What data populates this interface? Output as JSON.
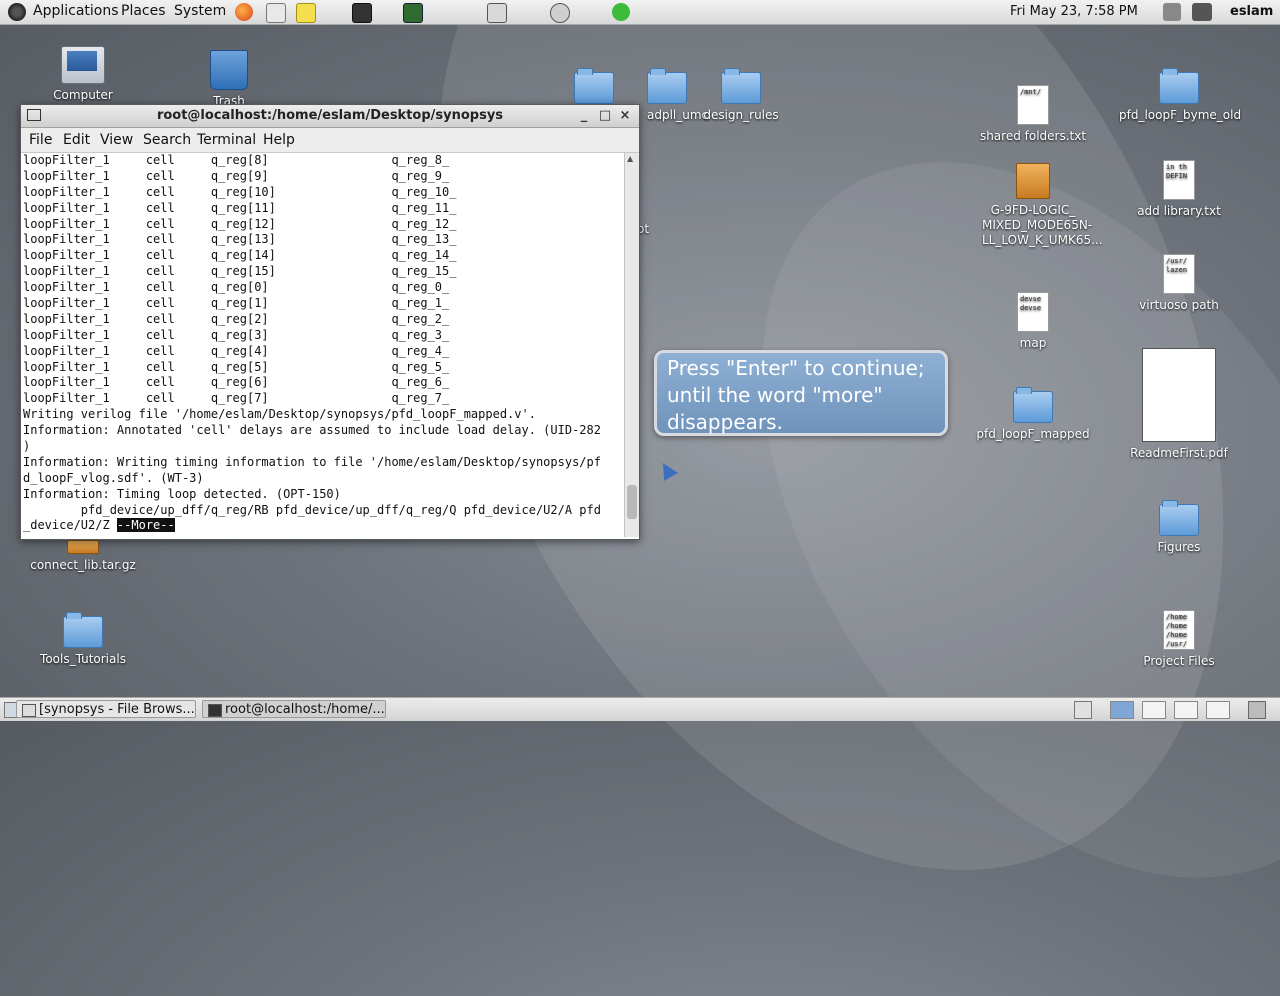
{
  "top_panel": {
    "menus": [
      "Applications",
      "Places",
      "System"
    ],
    "clock": "Fri May 23,  7:58 PM",
    "user": "eslam"
  },
  "desktop_icons": {
    "computer": "Computer",
    "trash": "Trash",
    "connect_lib": "connect_lib.tar.gz",
    "tools_tutorials": "Tools_Tutorials",
    "adpll_umc": "adpll_umc",
    "design_rules": "design_rules",
    "partial_label": "ot",
    "shared_folders": "shared folders.txt",
    "g9fd": "G-9FD-LOGIC_ MIXED_MODE65N- LL_LOW_K_UMK65...",
    "map": "map",
    "pfd_mapped": "pfd_loopF_mapped",
    "pfd_byme_old": "pfd_loopF_byme_old",
    "add_library": "add library.txt",
    "virtuoso_path": "virtuoso path",
    "readme": "ReadmeFirst.pdf",
    "figures": "Figures",
    "project_files": "Project Files"
  },
  "doc_thumbs": {
    "shared": "/mnt/",
    "add_library": "in th\nDEFIN",
    "virtuoso": "/usr/\nlazen",
    "map": "devse\ndevse",
    "project": "/home\n/home\n/home\n/usr/"
  },
  "terminal": {
    "title": "root@localhost:/home/eslam/Desktop/synopsys",
    "menu": [
      "File",
      "Edit",
      "View",
      "Search",
      "Terminal",
      "Help"
    ],
    "lines": [
      "loopFilter_1     cell     q_reg[8]                 q_reg_8_",
      "loopFilter_1     cell     q_reg[9]                 q_reg_9_",
      "loopFilter_1     cell     q_reg[10]                q_reg_10_",
      "loopFilter_1     cell     q_reg[11]                q_reg_11_",
      "loopFilter_1     cell     q_reg[12]                q_reg_12_",
      "loopFilter_1     cell     q_reg[13]                q_reg_13_",
      "loopFilter_1     cell     q_reg[14]                q_reg_14_",
      "loopFilter_1     cell     q_reg[15]                q_reg_15_",
      "loopFilter_1     cell     q_reg[0]                 q_reg_0_",
      "loopFilter_1     cell     q_reg[1]                 q_reg_1_",
      "loopFilter_1     cell     q_reg[2]                 q_reg_2_",
      "loopFilter_1     cell     q_reg[3]                 q_reg_3_",
      "loopFilter_1     cell     q_reg[4]                 q_reg_4_",
      "loopFilter_1     cell     q_reg[5]                 q_reg_5_",
      "loopFilter_1     cell     q_reg[6]                 q_reg_6_",
      "loopFilter_1     cell     q_reg[7]                 q_reg_7_",
      "Writing verilog file '/home/eslam/Desktop/synopsys/pfd_loopF_mapped.v'.",
      "Information: Annotated 'cell' delays are assumed to include load delay. (UID-282",
      ")",
      "Information: Writing timing information to file '/home/eslam/Desktop/synopsys/pf",
      "d_loopF_vlog.sdf'. (WT-3)",
      "Information: Timing loop detected. (OPT-150)",
      "        pfd_device/up_dff/q_reg/RB pfd_device/up_dff/q_reg/Q pfd_device/U2/A pfd",
      "_device/U2/Z "
    ],
    "more_prompt": "--More--"
  },
  "callout": {
    "text": "Press \"Enter\" to continue; until the word \"more\" disappears."
  },
  "taskbar": {
    "task1": "[synopsys - File Brows...",
    "task2": "root@localhost:/home/..."
  }
}
